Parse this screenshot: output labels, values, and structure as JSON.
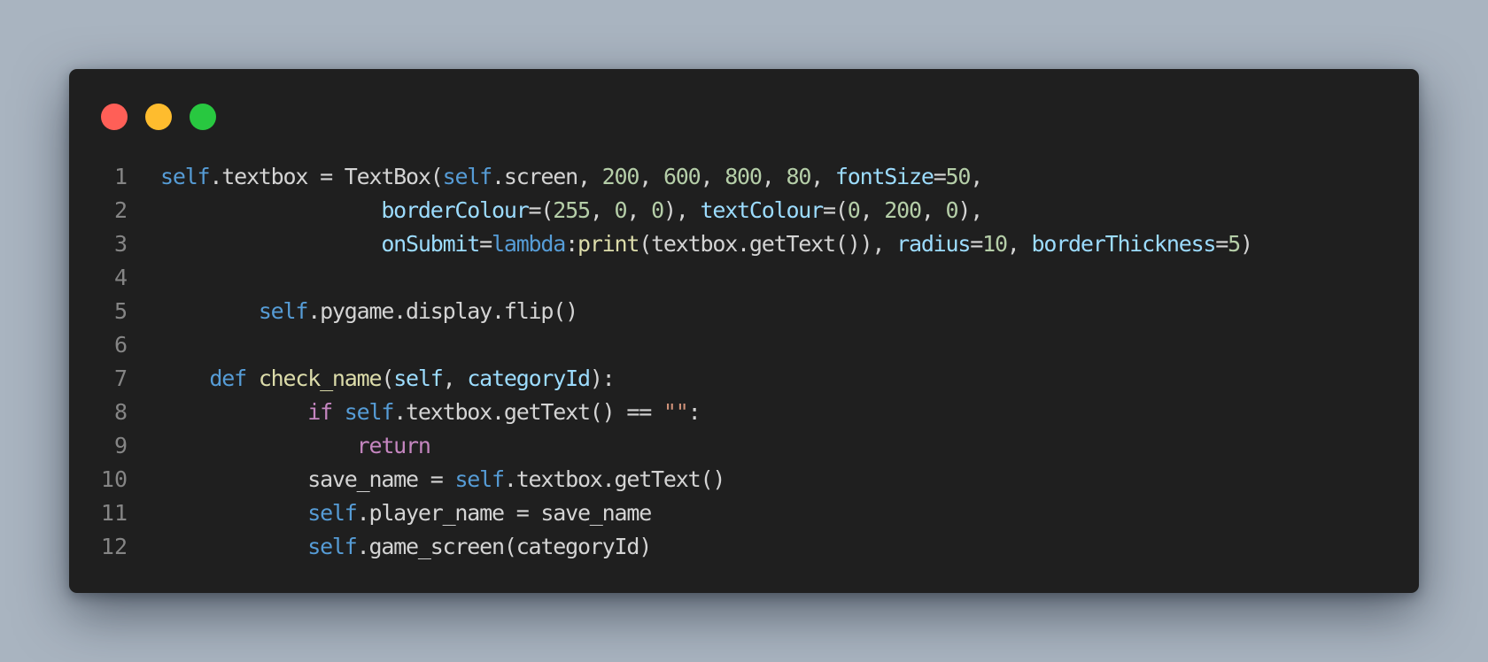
{
  "window": {
    "controls": [
      {
        "name": "close",
        "color": "#ff5f57"
      },
      {
        "name": "minimize",
        "color": "#febc2e"
      },
      {
        "name": "maximize",
        "color": "#28c840"
      }
    ]
  },
  "colors": {
    "background": "#a9b4c0",
    "editor": "#1f1f1f",
    "line_number": "#858585"
  },
  "code": {
    "language": "python",
    "lines": [
      {
        "number": "1",
        "tokens": [
          {
            "t": "self",
            "k": "self"
          },
          {
            "t": ".textbox = TextBox(",
            "k": "plain"
          },
          {
            "t": "self",
            "k": "self"
          },
          {
            "t": ".screen, ",
            "k": "plain"
          },
          {
            "t": "200",
            "k": "num"
          },
          {
            "t": ", ",
            "k": "plain"
          },
          {
            "t": "600",
            "k": "num"
          },
          {
            "t": ", ",
            "k": "plain"
          },
          {
            "t": "800",
            "k": "num"
          },
          {
            "t": ", ",
            "k": "plain"
          },
          {
            "t": "80",
            "k": "num"
          },
          {
            "t": ", ",
            "k": "plain"
          },
          {
            "t": "fontSize",
            "k": "param"
          },
          {
            "t": "=",
            "k": "plain"
          },
          {
            "t": "50",
            "k": "num"
          },
          {
            "t": ",",
            "k": "plain"
          }
        ]
      },
      {
        "number": "2",
        "tokens": [
          {
            "t": "                  ",
            "k": "plain"
          },
          {
            "t": "borderColour",
            "k": "param"
          },
          {
            "t": "=(",
            "k": "plain"
          },
          {
            "t": "255",
            "k": "num"
          },
          {
            "t": ", ",
            "k": "plain"
          },
          {
            "t": "0",
            "k": "num"
          },
          {
            "t": ", ",
            "k": "plain"
          },
          {
            "t": "0",
            "k": "num"
          },
          {
            "t": "), ",
            "k": "plain"
          },
          {
            "t": "textColour",
            "k": "param"
          },
          {
            "t": "=(",
            "k": "plain"
          },
          {
            "t": "0",
            "k": "num"
          },
          {
            "t": ", ",
            "k": "plain"
          },
          {
            "t": "200",
            "k": "num"
          },
          {
            "t": ", ",
            "k": "plain"
          },
          {
            "t": "0",
            "k": "num"
          },
          {
            "t": "),",
            "k": "plain"
          }
        ]
      },
      {
        "number": "3",
        "tokens": [
          {
            "t": "                  ",
            "k": "plain"
          },
          {
            "t": "onSubmit",
            "k": "param"
          },
          {
            "t": "=",
            "k": "plain"
          },
          {
            "t": "lambda",
            "k": "kw"
          },
          {
            "t": ":",
            "k": "plain"
          },
          {
            "t": "print",
            "k": "fn"
          },
          {
            "t": "(textbox.getText()), ",
            "k": "plain"
          },
          {
            "t": "radius",
            "k": "param"
          },
          {
            "t": "=",
            "k": "plain"
          },
          {
            "t": "10",
            "k": "num"
          },
          {
            "t": ", ",
            "k": "plain"
          },
          {
            "t": "borderThickness",
            "k": "param"
          },
          {
            "t": "=",
            "k": "plain"
          },
          {
            "t": "5",
            "k": "num"
          },
          {
            "t": ")",
            "k": "plain"
          }
        ]
      },
      {
        "number": "4",
        "tokens": []
      },
      {
        "number": "5",
        "tokens": [
          {
            "t": "        ",
            "k": "plain"
          },
          {
            "t": "self",
            "k": "self"
          },
          {
            "t": ".pygame.display.flip()",
            "k": "plain"
          }
        ]
      },
      {
        "number": "6",
        "tokens": []
      },
      {
        "number": "7",
        "tokens": [
          {
            "t": "    ",
            "k": "plain"
          },
          {
            "t": "def",
            "k": "kw"
          },
          {
            "t": " ",
            "k": "plain"
          },
          {
            "t": "check_name",
            "k": "fn"
          },
          {
            "t": "(",
            "k": "plain"
          },
          {
            "t": "self",
            "k": "param"
          },
          {
            "t": ", ",
            "k": "plain"
          },
          {
            "t": "categoryId",
            "k": "param"
          },
          {
            "t": "):",
            "k": "plain"
          }
        ]
      },
      {
        "number": "8",
        "tokens": [
          {
            "t": "            ",
            "k": "plain"
          },
          {
            "t": "if",
            "k": "ctrl"
          },
          {
            "t": " ",
            "k": "plain"
          },
          {
            "t": "self",
            "k": "self"
          },
          {
            "t": ".textbox.getText() == ",
            "k": "plain"
          },
          {
            "t": "\"\"",
            "k": "str"
          },
          {
            "t": ":",
            "k": "plain"
          }
        ]
      },
      {
        "number": "9",
        "tokens": [
          {
            "t": "                ",
            "k": "plain"
          },
          {
            "t": "return",
            "k": "ctrl"
          }
        ]
      },
      {
        "number": "10",
        "tokens": [
          {
            "t": "            save_name = ",
            "k": "plain"
          },
          {
            "t": "self",
            "k": "self"
          },
          {
            "t": ".textbox.getText()",
            "k": "plain"
          }
        ]
      },
      {
        "number": "11",
        "tokens": [
          {
            "t": "            ",
            "k": "plain"
          },
          {
            "t": "self",
            "k": "self"
          },
          {
            "t": ".player_name = save_name",
            "k": "plain"
          }
        ]
      },
      {
        "number": "12",
        "tokens": [
          {
            "t": "            ",
            "k": "plain"
          },
          {
            "t": "self",
            "k": "self"
          },
          {
            "t": ".game_screen(categoryId)",
            "k": "plain"
          }
        ]
      }
    ]
  }
}
